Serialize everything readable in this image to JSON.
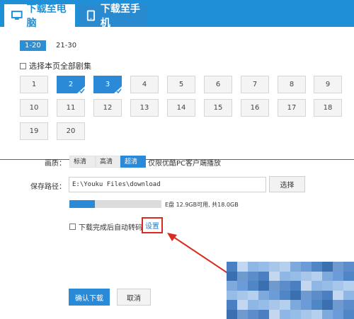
{
  "tabs": {
    "pc": "下载至电脑",
    "phone": "下载至手机"
  },
  "ranges": [
    "1-20",
    "21-30"
  ],
  "select_all": "选择本页全部剧集",
  "episodes": [
    "1",
    "2",
    "3",
    "4",
    "5",
    "6",
    "7",
    "8",
    "9",
    "10",
    "11",
    "12",
    "13",
    "14",
    "15",
    "16",
    "17",
    "18",
    "19",
    "20"
  ],
  "selected_episodes": [
    "2",
    "3"
  ],
  "quality": {
    "label": "画质：",
    "options": [
      "标清",
      "高清",
      "超清"
    ],
    "selected": "超清",
    "note": "仅限优酷PC客户端播放"
  },
  "save_path": {
    "label": "保存路径：",
    "value": "E:\\Youku Files\\download",
    "browse": "选择"
  },
  "disk": {
    "text": "E盘 12.9GB可用, 共18.0GB",
    "used_fraction": 0.28
  },
  "auto_convert": {
    "label": "下载完成后自动转码",
    "settings_link": "设置"
  },
  "buttons": {
    "confirm": "确认下载",
    "cancel": "取消"
  },
  "colors": {
    "accent": "#1f8fd8",
    "annotation_red": "#d82b22"
  }
}
